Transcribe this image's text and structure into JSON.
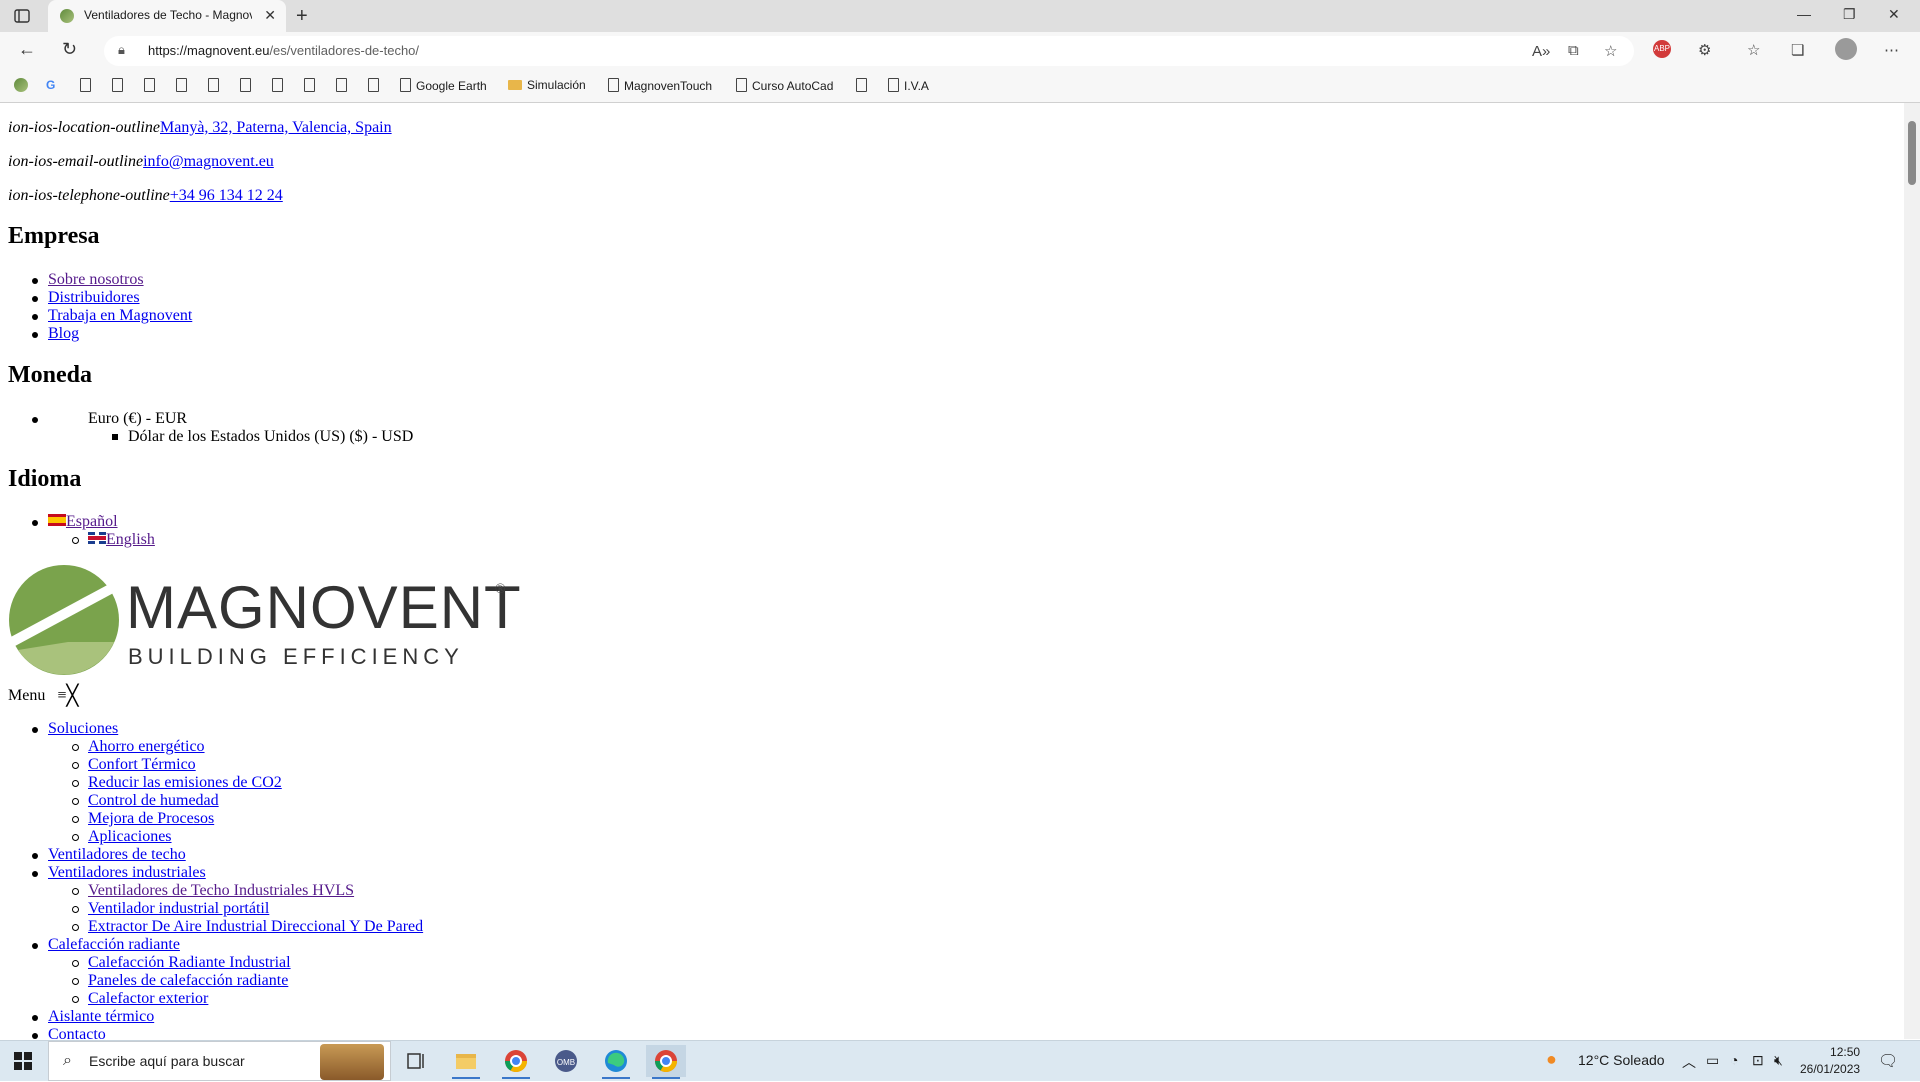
{
  "browser": {
    "tab_title": "Ventiladores de Techo - Magnovent",
    "url_scheme": "https://",
    "url_host": "magnovent.eu",
    "url_path": "/es/ventiladores-de-techo/"
  },
  "bookmarks": [
    {
      "label": "Google Earth",
      "icon": "doc-icon"
    },
    {
      "label": "Simulación",
      "icon": "folder-icon"
    },
    {
      "label": "MagnovenTouch",
      "icon": "doc-icon"
    },
    {
      "label": "Curso AutoCad",
      "icon": "doc-icon"
    },
    {
      "label": "I.V.A",
      "icon": "doc-icon"
    }
  ],
  "contact": {
    "location_icon": "ion-ios-location-outline",
    "location": "Manyà, 32, Paterna, Valencia, Spain",
    "email_icon": "ion-ios-email-outline",
    "email": "info@magnovent.eu",
    "phone_icon": "ion-ios-telephone-outline",
    "phone": "+34 96 134 12 24"
  },
  "empresa": {
    "heading": "Empresa",
    "links": [
      "Sobre nosotros",
      "Distribuidores",
      "Trabaja en Magnovent",
      "Blog"
    ]
  },
  "moneda": {
    "heading": "Moneda",
    "current": "Euro (€) - EUR",
    "other": "Dólar de los Estados Unidos (US) ($) - USD"
  },
  "idioma": {
    "heading": "Idioma",
    "current": "Español",
    "other": "English"
  },
  "logo": {
    "name": "MAGNOVENT",
    "tagline": "BUILDING EFFICIENCY",
    "mark": "®"
  },
  "menu": {
    "label": "Menu",
    "items": [
      {
        "label": "Soluciones",
        "children": [
          "Ahorro energético",
          "Confort Térmico",
          "Reducir las emisiones de CO2",
          "Control de humedad",
          "Mejora de Procesos",
          "Aplicaciones"
        ]
      },
      {
        "label": "Ventiladores de techo",
        "children": []
      },
      {
        "label": "Ventiladores industriales",
        "children": [
          "Ventiladores de Techo Industriales HVLS",
          "Ventilador industrial portátil",
          "Extractor De Aire Industrial Direccional Y De Pared"
        ]
      },
      {
        "label": "Calefacción radiante",
        "children": [
          "Calefacción Radiante Industrial",
          "Paneles de calefacción radiante",
          "Calefactor exterior"
        ]
      },
      {
        "label": "Aislante térmico",
        "children": []
      },
      {
        "label": "Contacto",
        "children": []
      }
    ]
  },
  "taskbar": {
    "search_placeholder": "Escribe aquí para buscar",
    "weather": "12°C  Soleado",
    "time": "12:50",
    "date": "26/01/2023"
  },
  "colors": {
    "link": "#0000ee",
    "visited": "#551a8b",
    "logo_green": "#6e9a45",
    "taskbar": "#dce8f1"
  }
}
